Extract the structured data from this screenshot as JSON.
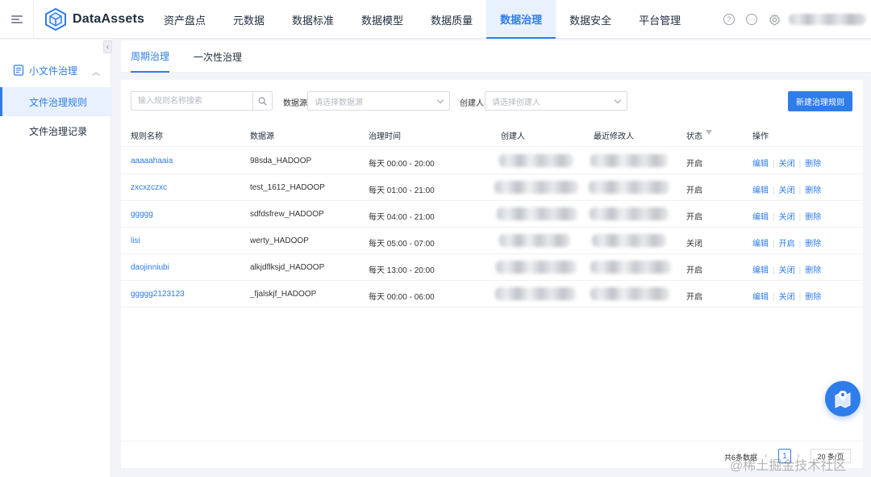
{
  "app": {
    "brand": "DataAssets"
  },
  "nav": {
    "items": [
      {
        "label": "资产盘点"
      },
      {
        "label": "元数据"
      },
      {
        "label": "数据标准"
      },
      {
        "label": "数据模型"
      },
      {
        "label": "数据质量"
      },
      {
        "label": "数据治理",
        "active": true
      },
      {
        "label": "数据安全"
      },
      {
        "label": "平台管理"
      }
    ],
    "icons": [
      "help-icon",
      "message-icon",
      "gear-icon"
    ]
  },
  "sidebar": {
    "group_label": "小文件治理",
    "items": [
      {
        "label": "文件治理规则",
        "active": true
      },
      {
        "label": "文件治理记录"
      }
    ]
  },
  "subtabs": [
    {
      "label": "周期治理",
      "active": true
    },
    {
      "label": "一次性治理"
    }
  ],
  "filters": {
    "search_placeholder": "输入规则名称搜索",
    "datasource_label": "数据源",
    "datasource_placeholder": "请选择数据源",
    "creator_label": "创建人",
    "creator_placeholder": "请选择创建人",
    "new_button": "新建治理规则"
  },
  "table": {
    "headers": [
      "规则名称",
      "数据源",
      "治理时间",
      "创建人",
      "最近修改人",
      "状态",
      "操作"
    ],
    "rows": [
      {
        "name": "aaaaahaaia",
        "source": "98sda_HADOOP",
        "time": "每天 00:00 - 20:00",
        "status": "开启",
        "toggle": "关闭"
      },
      {
        "name": "zxcxzczxc",
        "source": "test_1612_HADOOP",
        "time": "每天 01:00 - 21:00",
        "status": "开启",
        "toggle": "关闭"
      },
      {
        "name": "ggggg",
        "source": "sdfdsfrew_HADOOP",
        "time": "每天 04:00 - 21:00",
        "status": "开启",
        "toggle": "关闭"
      },
      {
        "name": "lisi",
        "source": "werty_HADOOP",
        "time": "每天 05:00 - 07:00",
        "status": "关闭",
        "toggle": "开启"
      },
      {
        "name": "daojinniubi",
        "source": "alkjdflksjd_HADOOP",
        "time": "每天 13:00 - 20:00",
        "status": "开启",
        "toggle": "关闭"
      },
      {
        "name": "ggggg2123123",
        "source": "_fjalskjf_HADOOP",
        "time": "每天 00:00 - 06:00",
        "status": "开启",
        "toggle": "关闭"
      }
    ],
    "op_edit": "编辑",
    "op_delete": "删除"
  },
  "pagination": {
    "total": "共6条数据",
    "current_page": "1",
    "page_size": "20 条/页"
  },
  "watermark": "@稀土掘金技术社区",
  "colors": {
    "accent": "#2f7ceb",
    "active_bg": "#e8f1fd"
  }
}
